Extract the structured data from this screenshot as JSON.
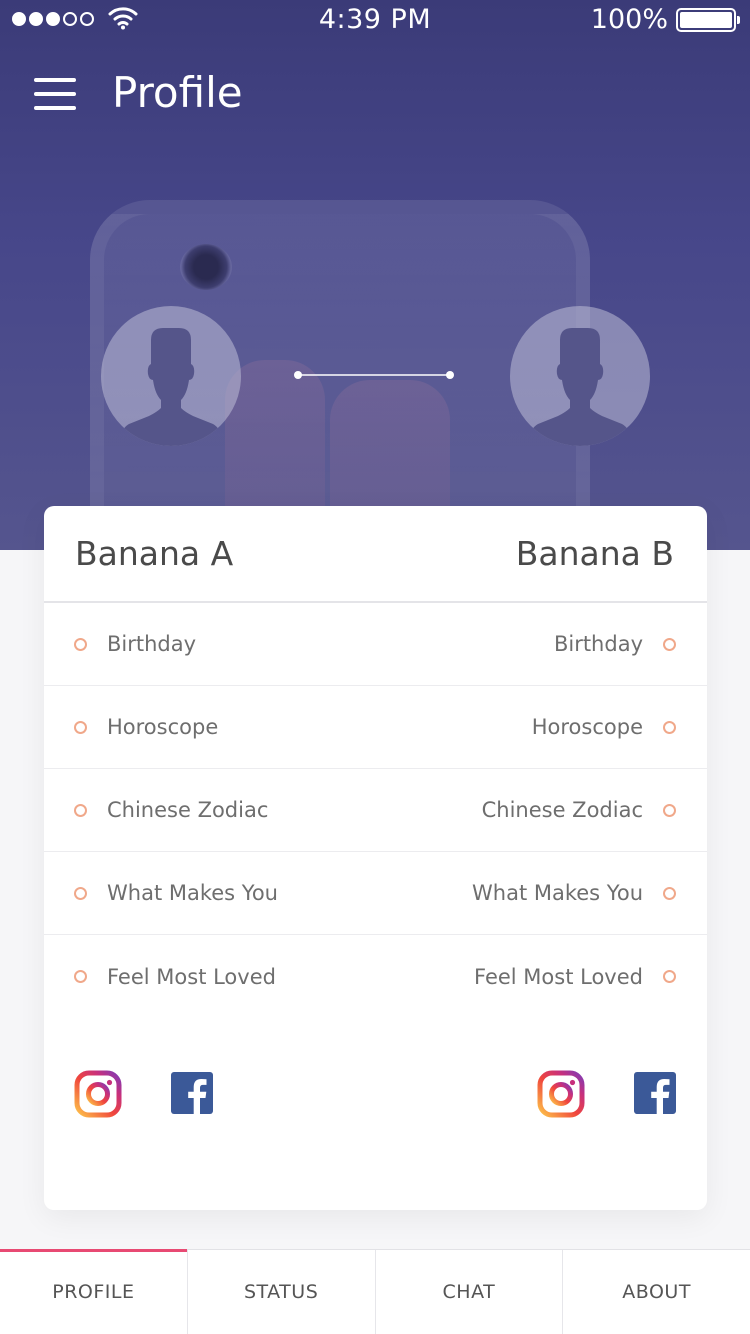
{
  "status_bar": {
    "time": "4:39 PM",
    "battery": "100%"
  },
  "header": {
    "title": "Profile"
  },
  "profile": {
    "person_a": {
      "name": "Banana A"
    },
    "person_b": {
      "name": "Banana B"
    },
    "rows": [
      {
        "left": "Birthday",
        "right": "Birthday"
      },
      {
        "left": "Horoscope",
        "right": "Horoscope"
      },
      {
        "left": "Chinese Zodiac",
        "right": "Chinese Zodiac"
      },
      {
        "left": "What Makes You",
        "right": "What Makes You"
      },
      {
        "left": "Feel Most Loved",
        "right": "Feel Most Loved"
      }
    ]
  },
  "tabs": [
    {
      "label": "PROFILE",
      "active": true
    },
    {
      "label": "STATUS"
    },
    {
      "label": "CHAT"
    },
    {
      "label": "ABOUT"
    }
  ],
  "colors": {
    "header_bg": "#3b3b78",
    "accent": "#e84a73",
    "row_dot": "#f0a88a",
    "facebook": "#3b5998"
  },
  "icons": [
    "menu-icon",
    "wifi-icon",
    "battery-icon",
    "avatar-icon",
    "instagram-icon",
    "facebook-icon"
  ]
}
